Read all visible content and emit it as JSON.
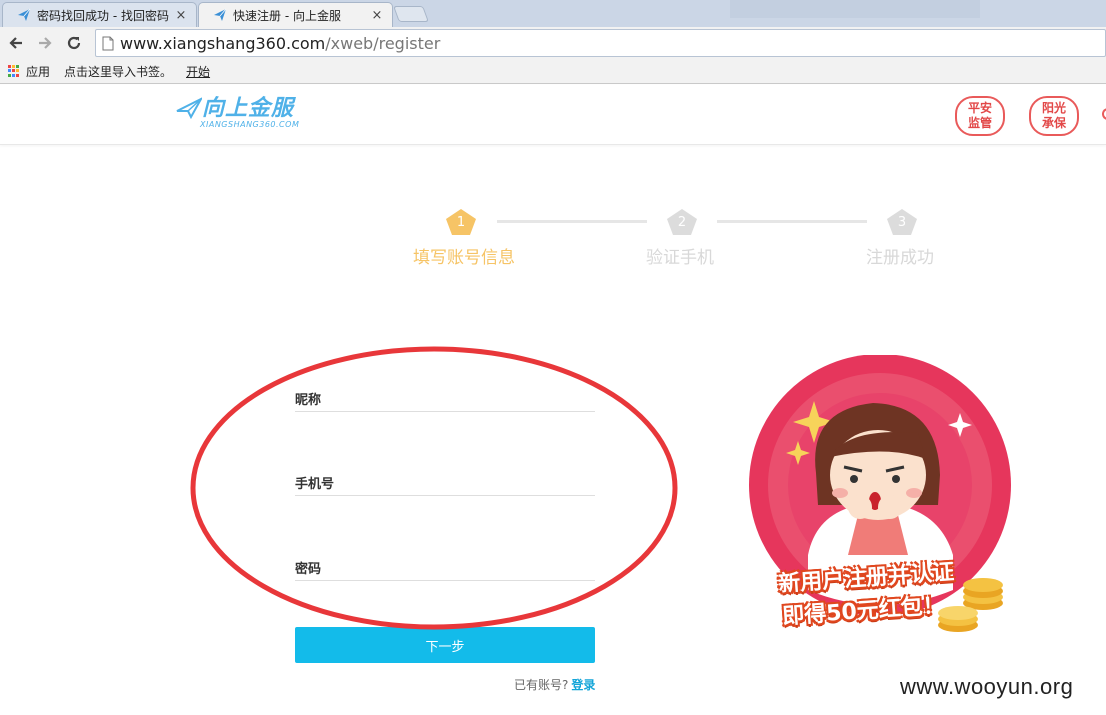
{
  "browser": {
    "tabs": [
      {
        "title": "密码找回成功 - 找回密码",
        "active": false
      },
      {
        "title": "快速注册 - 向上金服",
        "active": true
      }
    ],
    "close_glyph": "×",
    "url_host": "www.xiangshang360.com",
    "url_path": "/xweb/register",
    "bookmarks": {
      "apps_label": "应用",
      "import_label": "点击这里导入书签。",
      "start_label": "开始"
    }
  },
  "header": {
    "logo_text": "向上金服",
    "logo_sub": "XIANGSHANG360.COM",
    "badges": [
      {
        "line1": "平安",
        "line2": "监管"
      },
      {
        "line1": "阳光",
        "line2": "承保"
      }
    ]
  },
  "steps": [
    {
      "num": "1",
      "label": "填写账号信息",
      "state": "active"
    },
    {
      "num": "2",
      "label": "验证手机",
      "state": "pending"
    },
    {
      "num": "3",
      "label": "注册成功",
      "state": "pending"
    }
  ],
  "form": {
    "nickname_label": "昵称",
    "phone_label": "手机号",
    "password_label": "密码",
    "next_button": "下一步",
    "has_account_text": "已有账号?",
    "login_link": "登录"
  },
  "promo": {
    "line1": "新用户注册并认证",
    "line2": "即得50元红包！"
  },
  "watermark": "www.wooyun.org",
  "colors": {
    "active_step": "#f6c466",
    "pending_step": "#d8d8d8",
    "button": "#13bbea",
    "annotation": "#e8373a",
    "promo_circle": "#e6365c"
  }
}
